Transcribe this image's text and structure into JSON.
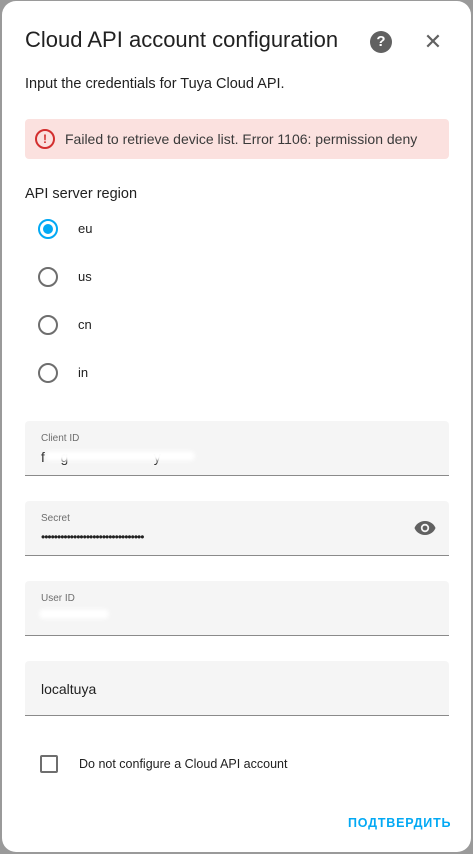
{
  "dialog": {
    "title": "Cloud API account configuration",
    "subtitle": "Input the credentials for Tuya Cloud API.",
    "error": "Failed to retrieve device list. Error 1106: permission deny",
    "region_label": "API server region",
    "regions": [
      {
        "label": "eu",
        "selected": true
      },
      {
        "label": "us",
        "selected": false
      },
      {
        "label": "cn",
        "selected": false
      },
      {
        "label": "in",
        "selected": false
      }
    ],
    "fields": {
      "client_id": {
        "label": "Client ID",
        "value": "f    g                      y"
      },
      "secret": {
        "label": "Secret",
        "value": "••••••••••••••••••••••••••••••••"
      },
      "user_id": {
        "label": "User ID",
        "value": ""
      },
      "name": {
        "label": "",
        "value": "localtuya"
      }
    },
    "no_cloud_label": "Do not configure a Cloud API account",
    "submit_label": "ПОДТВЕРДИТЬ"
  },
  "colors": {
    "accent": "#03a9f4",
    "error": "#d32f2f",
    "error_bg": "#fbe1df"
  },
  "icons": {
    "help": "help-circle-icon",
    "close": "close-icon",
    "error": "alert-circle-icon",
    "show_password": "eye-icon"
  }
}
